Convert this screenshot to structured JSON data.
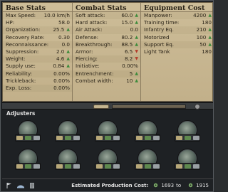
{
  "panels": {
    "base_stats": {
      "title": "Base Stats",
      "rows": [
        {
          "label": "Max Speed:",
          "value": "10.0 km/h"
        },
        {
          "label": "HP:",
          "value": "58.0"
        },
        {
          "label": "Organization:",
          "value": "25.5",
          "arrow": "up"
        },
        {
          "label": "Recovery Rate:",
          "value": "0.30"
        },
        {
          "label": "Reconnaissance:",
          "value": "0.0"
        },
        {
          "label": "Suppression:",
          "value": "2.0",
          "arrow": "up"
        },
        {
          "label": "Weight:",
          "value": "4.6",
          "arrow": "up"
        },
        {
          "label": "Supply use:",
          "value": "0.84",
          "arrow": "up"
        },
        {
          "label": "Reliability:",
          "value": "0.00%"
        },
        {
          "label": "Trickleback:",
          "value": "0.00%"
        },
        {
          "label": "Exp. Loss:",
          "value": "0.00%"
        }
      ]
    },
    "combat_stats": {
      "title": "Combat Stats",
      "rows": [
        {
          "label": "Soft attack:",
          "value": "60.0",
          "arrow": "up"
        },
        {
          "label": "Hard attack:",
          "value": "15.0",
          "arrow": "up"
        },
        {
          "label": "Air Attack:",
          "value": "0.0"
        },
        {
          "label": "Defense:",
          "value": "80.2",
          "arrow": "up"
        },
        {
          "label": "Breakthrough:",
          "value": "88.5",
          "arrow": "up"
        },
        {
          "label": "Armor:",
          "value": "6.5",
          "arrow": "down"
        },
        {
          "label": "Piercing:",
          "value": "8.2",
          "arrow": "down"
        },
        {
          "label": "Initiative:",
          "value": "0.00%"
        },
        {
          "label": "Entrenchment:",
          "value": "5",
          "arrow": "up"
        },
        {
          "label": "Combat width:",
          "value": "10",
          "arrow": "up"
        }
      ]
    },
    "equipment_cost": {
      "title": "Equipment Cost",
      "rows": [
        {
          "label": "Manpower:",
          "value": "4200",
          "arrow": "up"
        },
        {
          "label": "Training time:",
          "value": "180"
        },
        {
          "label": "Infantry Eq.",
          "value": "210",
          "arrow": "up"
        },
        {
          "label": "Motorized",
          "value": "100",
          "arrow": "up"
        },
        {
          "label": "Support Eq.",
          "value": "50",
          "arrow": "up"
        },
        {
          "label": "Light Tank",
          "value": "180"
        }
      ]
    }
  },
  "adjusters": {
    "title": "Adjusters",
    "count": 10
  },
  "footer": {
    "label": "Estimated Production Cost:",
    "from": "1693",
    "to_word": "to",
    "to": "1915"
  },
  "colors": {
    "arrow_up": "#3c8b3b",
    "arrow_down": "#b33a2a",
    "paper": "#c8b791"
  }
}
